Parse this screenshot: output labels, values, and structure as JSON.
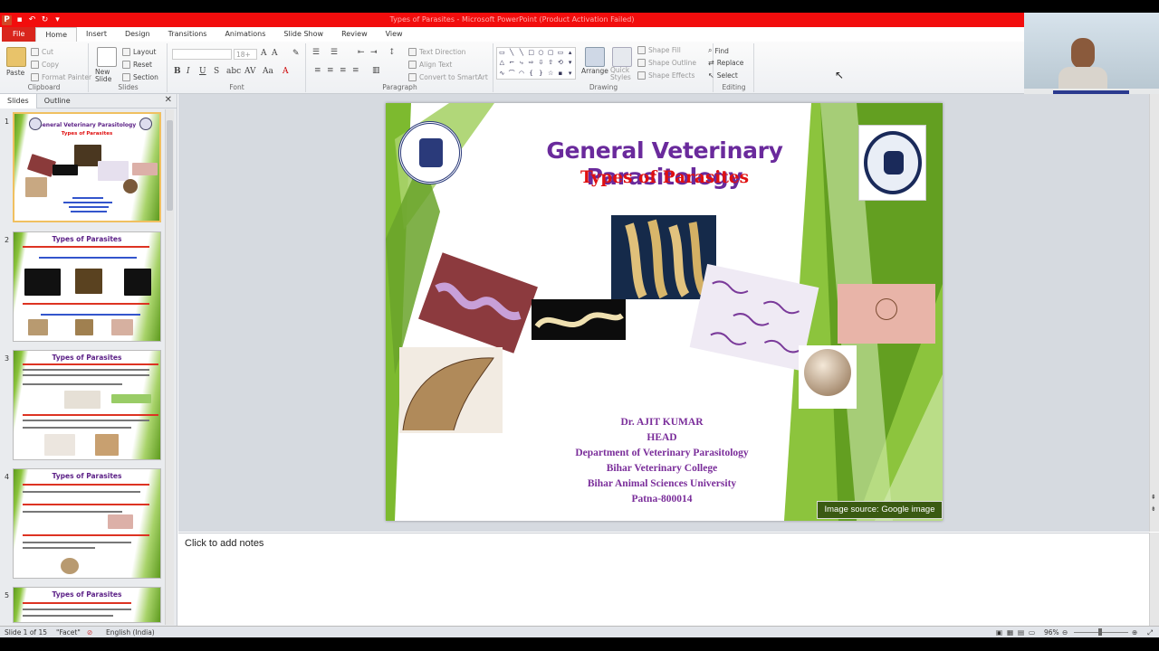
{
  "window": {
    "title": "Types of Parasites - Microsoft PowerPoint (Product Activation Failed)"
  },
  "tabs": [
    {
      "label": "File"
    },
    {
      "label": "Home"
    },
    {
      "label": "Insert"
    },
    {
      "label": "Design"
    },
    {
      "label": "Transitions"
    },
    {
      "label": "Animations"
    },
    {
      "label": "Slide Show"
    },
    {
      "label": "Review"
    },
    {
      "label": "View"
    }
  ],
  "ribbon": {
    "clipboard": {
      "paste": "Paste",
      "cut": "Cut",
      "copy": "Copy",
      "format_painter": "Format Painter",
      "label": "Clipboard"
    },
    "slides": {
      "new_slide": "New Slide",
      "layout": "Layout",
      "reset": "Reset",
      "section": "Section",
      "label": "Slides"
    },
    "font": {
      "size": "18+",
      "label": "Font"
    },
    "paragraph": {
      "text_direction": "Text Direction",
      "align_text": "Align Text",
      "convert_smartart": "Convert to SmartArt",
      "label": "Paragraph"
    },
    "drawing": {
      "arrange": "Arrange",
      "quick_styles": "Quick Styles",
      "shape_fill": "Shape Fill",
      "shape_outline": "Shape Outline",
      "shape_effects": "Shape Effects",
      "label": "Drawing"
    },
    "editing": {
      "find": "Find",
      "replace": "Replace",
      "select": "Select",
      "label": "Editing"
    }
  },
  "side_panel": {
    "tab_slides": "Slides",
    "tab_outline": "Outline",
    "thumbnails": [
      {
        "num": "1",
        "title": "General Veterinary Parasitology",
        "sub": "Types of Parasites"
      },
      {
        "num": "2",
        "title": "Types of Parasites",
        "sub": ""
      },
      {
        "num": "3",
        "title": "Types of Parasites",
        "sub": ""
      },
      {
        "num": "4",
        "title": "Types of Parasites",
        "sub": ""
      },
      {
        "num": "5",
        "title": "Types of Parasites",
        "sub": ""
      }
    ]
  },
  "slide": {
    "title": "General Veterinary Parasitology",
    "subtitle": "Types of Parasites",
    "author_lines": [
      "Dr. AJIT KUMAR",
      "HEAD",
      "Department of Veterinary Parasitology",
      "Bihar Veterinary College",
      "Bihar Animal Sciences University",
      "Patna-800014"
    ],
    "image_source": "Image source: Google image"
  },
  "notes": {
    "placeholder": "Click to add notes"
  },
  "status": {
    "slide_info": "Slide 1 of 15",
    "theme": "\"Facet\"",
    "language": "English (India)",
    "zoom": "96%"
  },
  "colors": {
    "title_purple": "#6a2a9c",
    "subtitle_red": "#e01010",
    "titlebar_red": "#f20d0d",
    "facet_green": "#7dba2f"
  }
}
